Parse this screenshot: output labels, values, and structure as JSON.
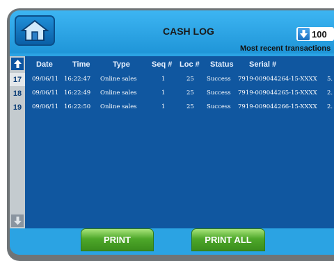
{
  "header": {
    "title": "CASH LOG",
    "count": "100",
    "subtitle": "Most recent transactions"
  },
  "columns": [
    "Date",
    "Time",
    "Type",
    "Seq #",
    "Loc #",
    "Status",
    "Serial #"
  ],
  "row_numbers": [
    "17",
    "18",
    "19"
  ],
  "rows": [
    {
      "date": "09/06/11",
      "time": "16:22:47",
      "type": "Online sales",
      "seq": "1",
      "loc": "25",
      "status": "Success",
      "serial": "7919-009044264-15-XXXX",
      "extra": "5."
    },
    {
      "date": "09/06/11",
      "time": "16:22:49",
      "type": "Online sales",
      "seq": "1",
      "loc": "25",
      "status": "Success",
      "serial": "7919-009044265-15-XXXX",
      "extra": "2."
    },
    {
      "date": "09/06/11",
      "time": "16:22:50",
      "type": "Online sales",
      "seq": "1",
      "loc": "25",
      "status": "Success",
      "serial": "7919-009044266-15-XXXX",
      "extra": "2."
    }
  ],
  "buttons": {
    "print": "PRINT",
    "print_all": "PRINT ALL"
  },
  "icons": {
    "home": "home-icon",
    "sort": "arrow-down-icon",
    "scroll_up": "arrow-up-icon",
    "scroll_down": "arrow-down-icon"
  },
  "colors": {
    "screen": "#2ba3e3",
    "table": "#1057a0",
    "button": "#4ea82a"
  }
}
